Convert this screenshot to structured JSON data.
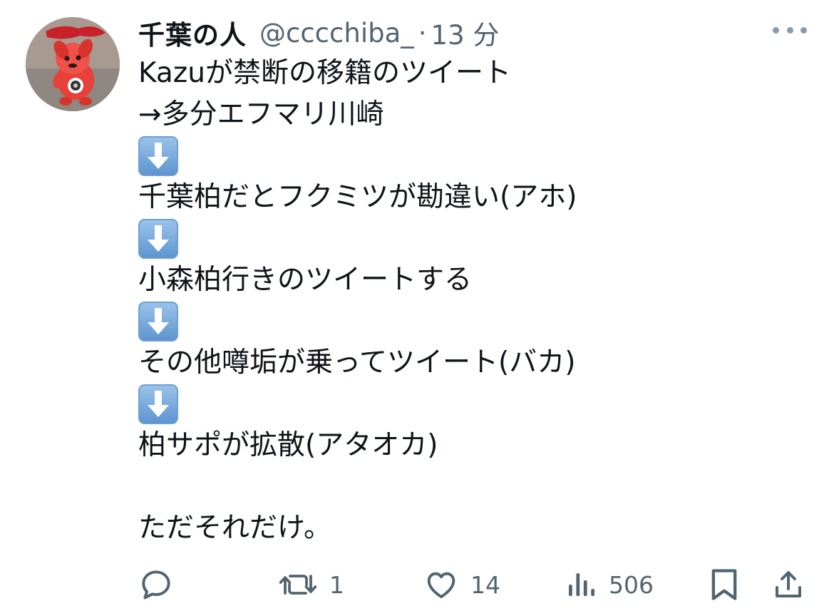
{
  "tweet": {
    "display_name": "千葉の人",
    "handle": "@cccchiba_",
    "separator": "·",
    "time": "13 分",
    "lines": [
      "Kazuが禁断の移籍のツイート",
      "→多分エフマリ川崎",
      "",
      "千葉柏だとフクミツが勘違い(アホ)",
      "",
      "小森柏行きのツイートする",
      "",
      "その他噂垢が乗ってツイート(バカ)",
      "",
      "柏サポが拡散(アタオカ)",
      "",
      "ただそれだけ。"
    ],
    "arrow_emoji": "⬇️"
  },
  "actions": {
    "reply": {
      "icon": "reply-icon",
      "count": ""
    },
    "retweet": {
      "icon": "retweet-icon",
      "count": "1"
    },
    "like": {
      "icon": "heart-icon",
      "count": "14"
    },
    "views": {
      "icon": "views-icon",
      "count": "506"
    },
    "bookmark": {
      "icon": "bookmark-icon",
      "count": ""
    },
    "share": {
      "icon": "share-icon",
      "count": ""
    }
  },
  "colors": {
    "text": "#0f1419",
    "secondary": "#536471",
    "avatar_mascot": "#e8413a"
  }
}
